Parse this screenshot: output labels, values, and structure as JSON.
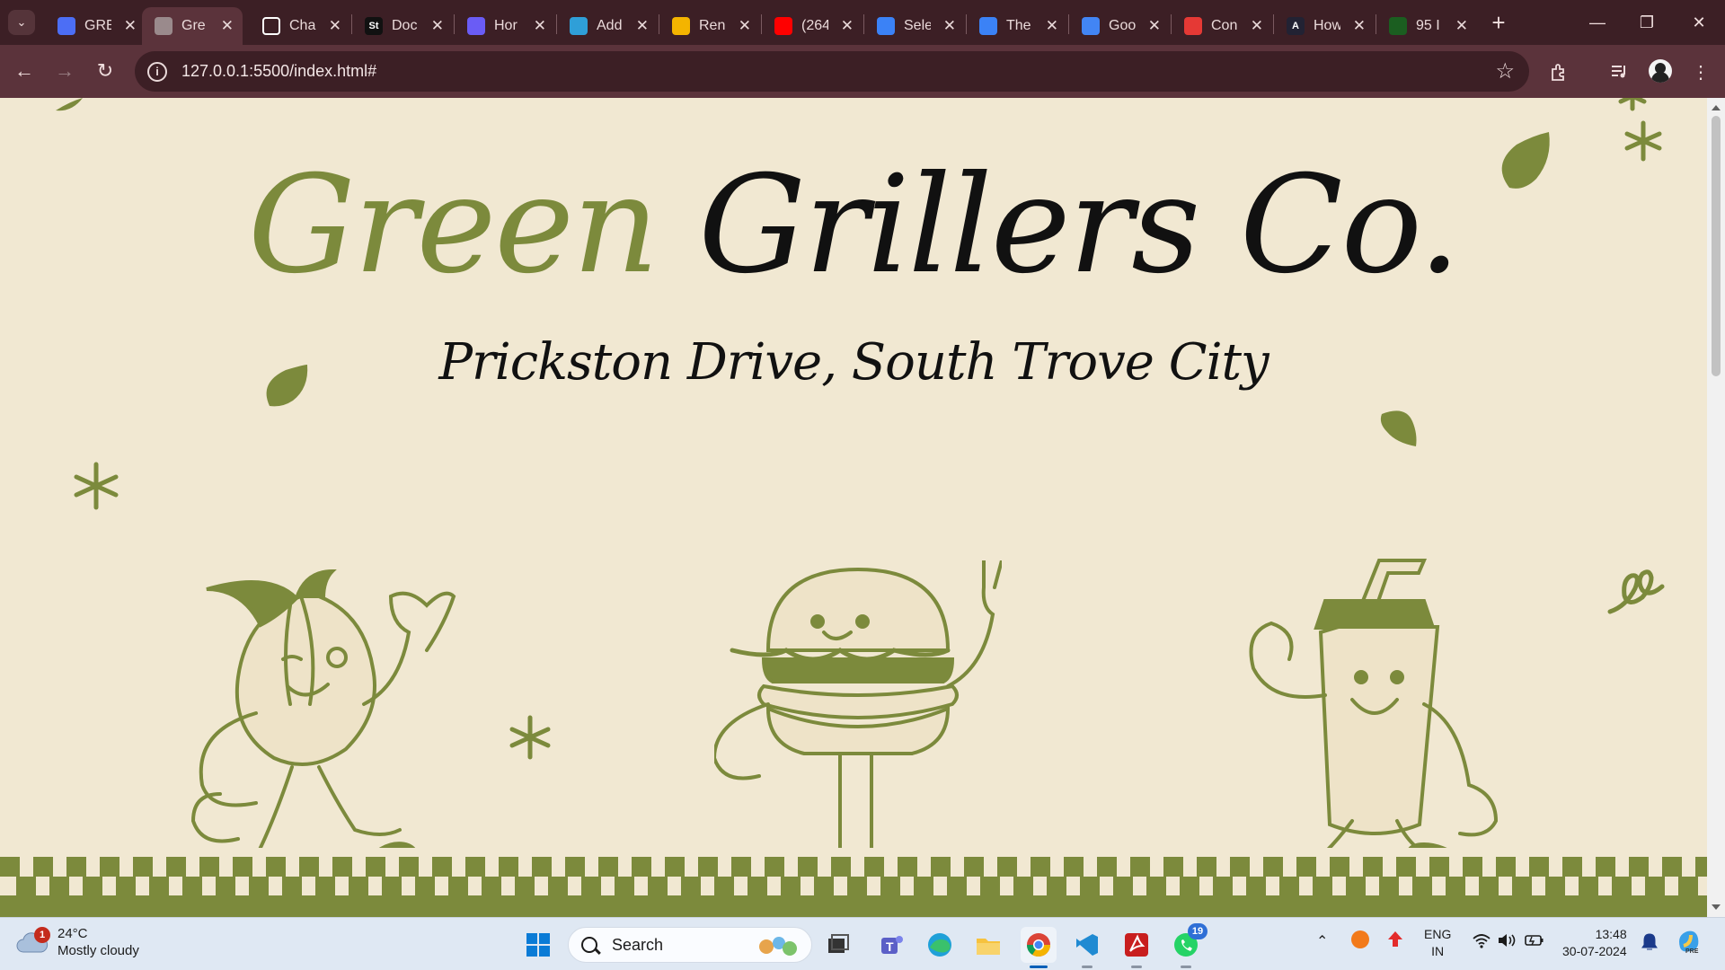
{
  "browser": {
    "tabs": [
      {
        "label": "GRE",
        "icon": "forms-icon",
        "color": "#4c6ef5"
      },
      {
        "label": "Gre",
        "icon": "globe-icon",
        "color": "#9a8a8c",
        "active": true
      },
      {
        "label": "Cha",
        "icon": "chatgpt-icon",
        "color": "#ffffff"
      },
      {
        "label": "Doc",
        "icon": "st-icon",
        "color": "#111111",
        "glyph": "St"
      },
      {
        "label": "Hor",
        "icon": "canva-icon",
        "color": "#6a5cf5"
      },
      {
        "label": "Add",
        "icon": "canva-icon",
        "color": "#2f9fd8"
      },
      {
        "label": "Ren",
        "icon": "slides-icon",
        "color": "#f4b400"
      },
      {
        "label": "(264",
        "icon": "youtube-icon",
        "color": "#ff0000"
      },
      {
        "label": "Sele",
        "icon": "aesthetic-icon",
        "color": "#3b82f6"
      },
      {
        "label": "The",
        "icon": "aesthetic-icon",
        "color": "#3b82f6"
      },
      {
        "label": "Goo",
        "icon": "lens-icon",
        "color": "#4285f4"
      },
      {
        "label": "Con",
        "icon": "pdf-icon",
        "color": "#e53935"
      },
      {
        "label": "How",
        "icon": "a-icon",
        "color": "#222233",
        "glyph": "A"
      },
      {
        "label": "95 I",
        "icon": "cursor-icon",
        "color": "#1b5e20"
      }
    ],
    "url": "127.0.0.1:5500/index.html#"
  },
  "page": {
    "title_green": "Green",
    "title_black": "Grillers Co.",
    "address": "Prickston Drive, South Trove City",
    "accent": "#7c8a3c",
    "background": "#f1e8d2"
  },
  "taskbar": {
    "weather": {
      "temp": "24°C",
      "condition": "Mostly cloudy",
      "badge": "1"
    },
    "search_label": "Search",
    "whatsapp_badge": "19",
    "lang_top": "ENG",
    "lang_bottom": "IN",
    "time": "13:48",
    "date": "30-07-2024"
  }
}
